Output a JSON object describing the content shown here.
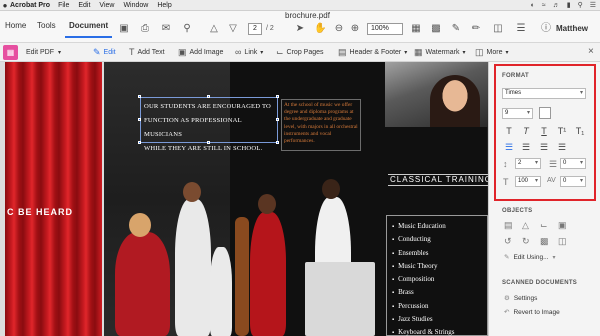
{
  "menubar": {
    "app": "Acrobat Pro",
    "items": [
      "File",
      "Edit",
      "View",
      "Window",
      "Help"
    ]
  },
  "window": {
    "title": "brochure.pdf"
  },
  "toolbar": {
    "tabs": [
      "Home",
      "Tools",
      "Document"
    ],
    "page_current": "2",
    "page_total": "/ 2",
    "zoom": "100%",
    "user": "Matthew"
  },
  "editbar": {
    "mode": "Edit PDF",
    "tools": [
      {
        "icon": "edit-icon",
        "label": "Edit"
      },
      {
        "icon": "text-icon",
        "label": "Add Text"
      },
      {
        "icon": "image-icon",
        "label": "Add Image"
      },
      {
        "icon": "link-icon",
        "label": "Link"
      },
      {
        "icon": "crop-icon",
        "label": "Crop Pages"
      },
      {
        "icon": "header-footer-icon",
        "label": "Header & Footer"
      },
      {
        "icon": "watermark-icon",
        "label": "Watermark"
      },
      {
        "icon": "more-icon",
        "label": "More"
      }
    ]
  },
  "document": {
    "heard": "C BE HEARD",
    "headline_lines": [
      "OUR STUDENTS ARE ENCOURAGED TO",
      "FUNCTION AS PROFESSIONAL MUSICIANS",
      "WHILE THEY ARE STILL IN SCHOOL."
    ],
    "side_text": "At the school of music we offer degree and diploma programs at the undergraduate and graduate level, with majors in all orchestral instruments and vocal performances.",
    "classical": "CLASSICAL TRAINING",
    "courses": [
      "Music Education",
      "Conducting",
      "Ensembles",
      "Music Theory",
      "Composition",
      "Brass",
      "Percussion",
      "Jazz Studies",
      "Keyboard & Strings"
    ]
  },
  "format_panel": {
    "title": "FORMAT",
    "font": "Times",
    "size": "9",
    "line_spacing": "2",
    "para_spacing": "0",
    "scale": "100",
    "char_spacing": "0"
  },
  "objects_panel": {
    "title": "OBJECTS",
    "edit_using": "Edit Using..."
  },
  "scanned_panel": {
    "title": "SCANNED DOCUMENTS",
    "settings": "Settings",
    "revert": "Revert to Image"
  }
}
